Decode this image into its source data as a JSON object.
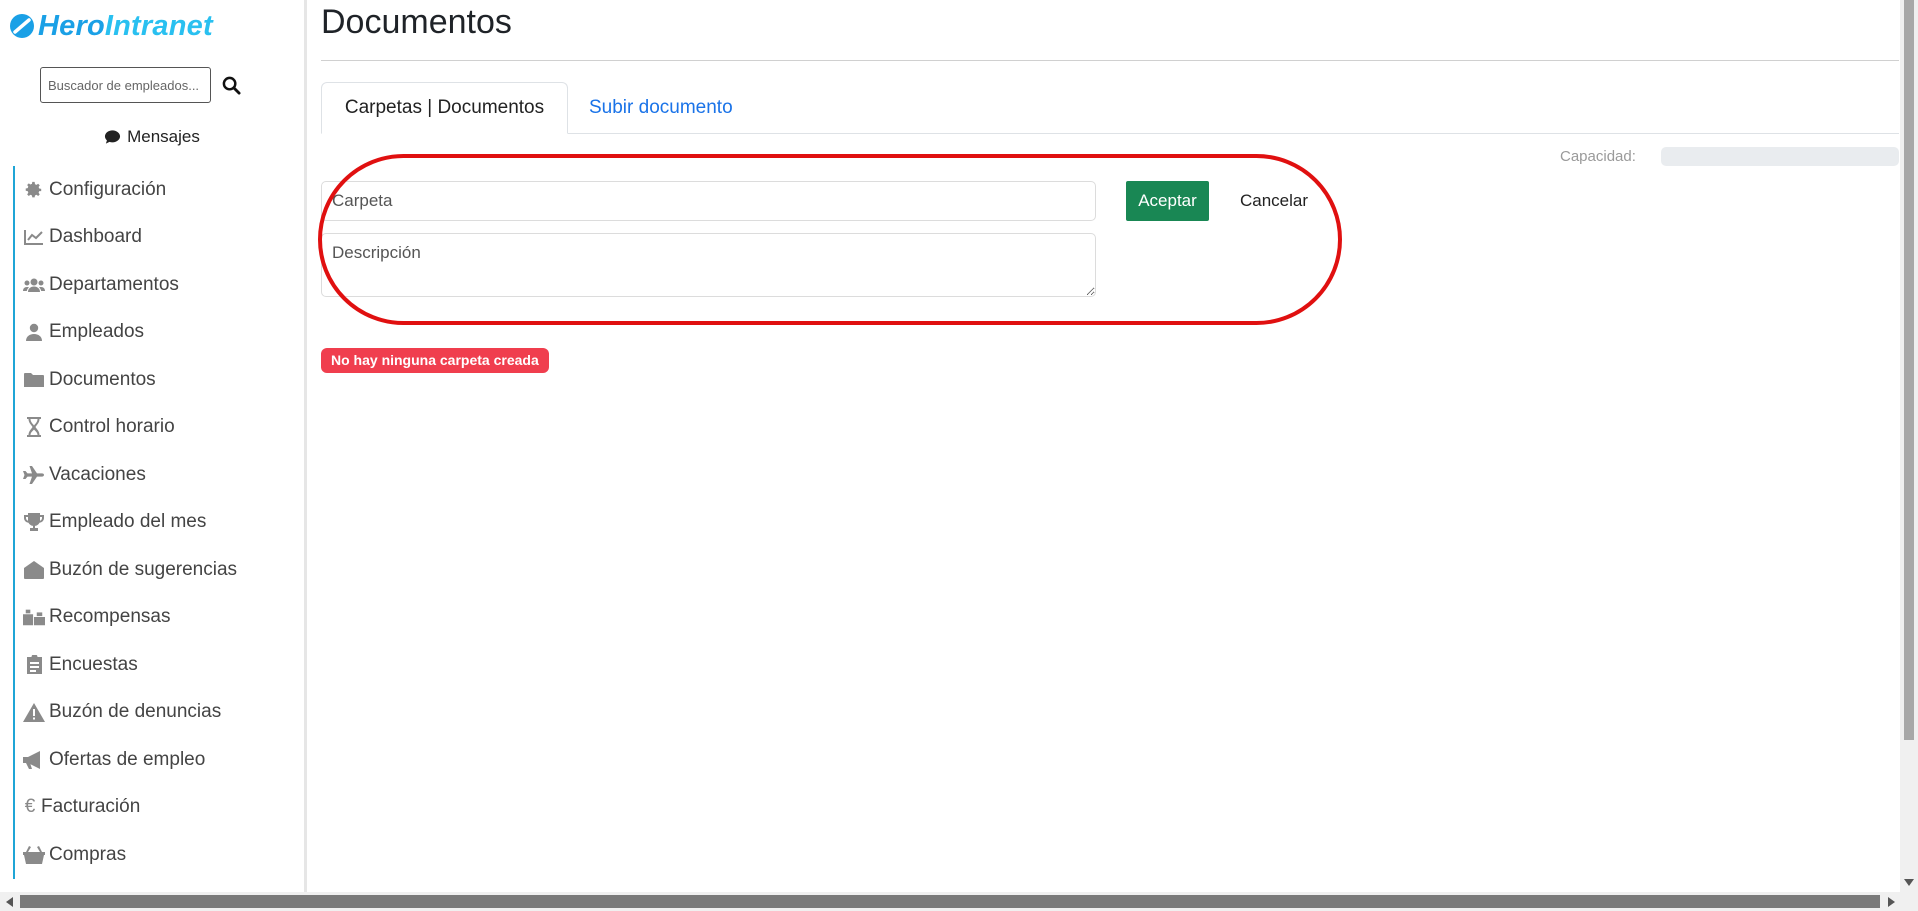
{
  "brand": {
    "part1": "Hero",
    "part2": "Intranet"
  },
  "sidebar": {
    "search_placeholder": "Buscador de empleados...",
    "messages_label": "Mensajes",
    "items": [
      {
        "label": "Configuración",
        "icon": "gear-icon"
      },
      {
        "label": "Dashboard",
        "icon": "chart-line-icon"
      },
      {
        "label": "Departamentos",
        "icon": "users-icon"
      },
      {
        "label": "Empleados",
        "icon": "user-icon"
      },
      {
        "label": "Documentos",
        "icon": "folder-icon"
      },
      {
        "label": "Control horario",
        "icon": "hourglass-icon"
      },
      {
        "label": "Vacaciones",
        "icon": "plane-icon"
      },
      {
        "label": "Empleado del mes",
        "icon": "trophy-icon"
      },
      {
        "label": "Buzón de sugerencias",
        "icon": "envelope-open-icon"
      },
      {
        "label": "Recompensas",
        "icon": "gifts-icon"
      },
      {
        "label": "Encuestas",
        "icon": "clipboard-list-icon"
      },
      {
        "label": "Buzón de denuncias",
        "icon": "warning-icon"
      },
      {
        "label": "Ofertas de empleo",
        "icon": "megaphone-icon"
      },
      {
        "label": "Facturación",
        "icon": "euro-icon"
      },
      {
        "label": "Compras",
        "icon": "basket-icon"
      }
    ]
  },
  "main": {
    "title": "Documentos",
    "tabs": [
      {
        "label": "Carpetas | Documentos",
        "active": true
      },
      {
        "label": "Subir documento",
        "active": false
      }
    ],
    "capacity": {
      "label": "Capacidad:",
      "fraction": 0.0
    },
    "form": {
      "folder_placeholder": "Carpeta",
      "description_placeholder": "Descripción",
      "accept_label": "Aceptar",
      "cancel_label": "Cancelar"
    },
    "empty_message": "No hay ninguna carpeta creada"
  },
  "colors": {
    "brand_blue": "#1aa0e6",
    "accent_link": "#1a73e8",
    "accept_green": "#198754",
    "danger_badge": "#f03e4e",
    "highlight_red": "#e01010",
    "sidebar_rule": "#1fa5d6"
  }
}
